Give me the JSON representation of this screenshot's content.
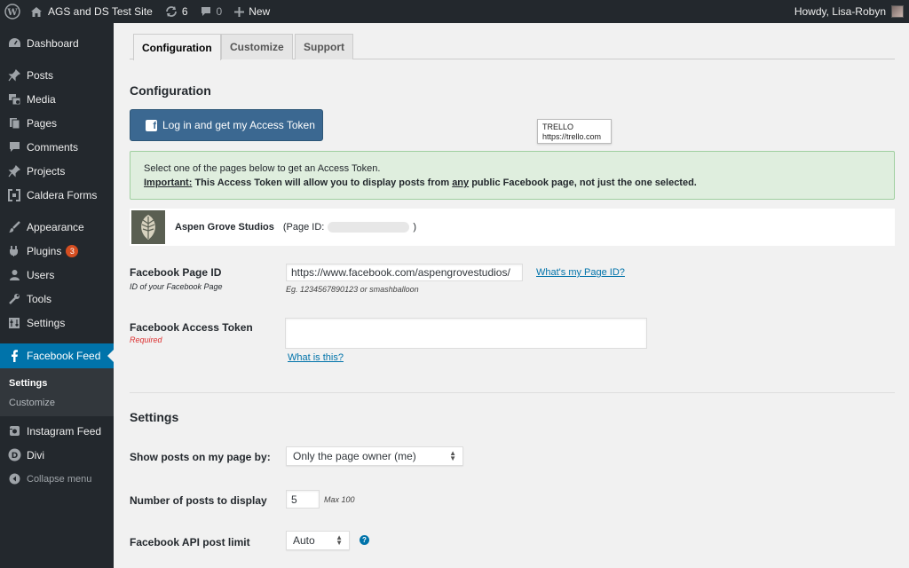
{
  "adminbar": {
    "site_name": "AGS and DS Test Site",
    "updates_count": "6",
    "comments_count": "0",
    "new_label": "New",
    "howdy": "Howdy, Lisa-Robyn",
    "icons": [
      "wordpress-icon",
      "home-icon",
      "updates-icon",
      "comment-icon",
      "plus-icon"
    ]
  },
  "sidebar": {
    "items": [
      {
        "label": "Dashboard",
        "icon": "dashboard-icon"
      },
      {
        "label": "Posts",
        "icon": "pin-icon"
      },
      {
        "label": "Media",
        "icon": "media-icon"
      },
      {
        "label": "Pages",
        "icon": "pages-icon"
      },
      {
        "label": "Comments",
        "icon": "comments-icon"
      },
      {
        "label": "Projects",
        "icon": "pin-icon"
      },
      {
        "label": "Caldera Forms",
        "icon": "caldera-icon"
      },
      {
        "label": "Appearance",
        "icon": "brush-icon"
      },
      {
        "label": "Plugins",
        "icon": "plugin-icon",
        "badge": "3"
      },
      {
        "label": "Users",
        "icon": "user-icon"
      },
      {
        "label": "Tools",
        "icon": "wrench-icon"
      },
      {
        "label": "Settings",
        "icon": "settings-icon"
      },
      {
        "label": "Facebook Feed",
        "icon": "facebook-icon"
      },
      {
        "label": "Instagram Feed",
        "icon": "instagram-icon"
      },
      {
        "label": "Divi",
        "icon": "divi-icon"
      }
    ],
    "submenu": [
      "Settings",
      "Customize"
    ],
    "collapse_label": "Collapse menu"
  },
  "tabs": [
    "Configuration",
    "Customize",
    "Support"
  ],
  "config": {
    "heading": "Configuration",
    "login_button": "Log in and get my Access Token",
    "tooltip_line1": "TRELLO",
    "tooltip_line2": "https://trello.com",
    "notice_line1": "Select one of the pages below to get an Access Token.",
    "notice_important": "Important:",
    "notice_line2a": " This Access Token will allow you to display posts from ",
    "notice_any": "any",
    "notice_line2b": " public Facebook page, not just the one selected.",
    "page_name": "Aspen Grove Studios",
    "page_id_open": "(Page ID:",
    "page_id_close": ")"
  },
  "fields": {
    "page_id_label": "Facebook Page ID",
    "page_id_sublabel": "ID of your Facebook Page",
    "page_id_value": "https://www.facebook.com/aspengrovestudios/",
    "page_id_link": "What's my Page ID?",
    "page_id_hint": "Eg. 1234567890123 or smashballoon",
    "token_label": "Facebook Access Token",
    "token_required": "Required",
    "token_value": "",
    "token_link": "What is this?"
  },
  "settings": {
    "heading": "Settings",
    "show_posts_label": "Show posts on my page by:",
    "show_posts_value": "Only the page owner (me)",
    "num_posts_label": "Number of posts to display",
    "num_posts_value": "5",
    "num_posts_hint": "Max 100",
    "api_limit_label": "Facebook API post limit",
    "api_limit_value": "Auto",
    "help_glyph": "?"
  },
  "colors": {
    "adminbar": "#23282d",
    "sidebar": "#23282d",
    "accent": "#0073aa",
    "fb_button": "#3b6891",
    "notice_bg": "#dfeede",
    "badge": "#d54e21"
  }
}
